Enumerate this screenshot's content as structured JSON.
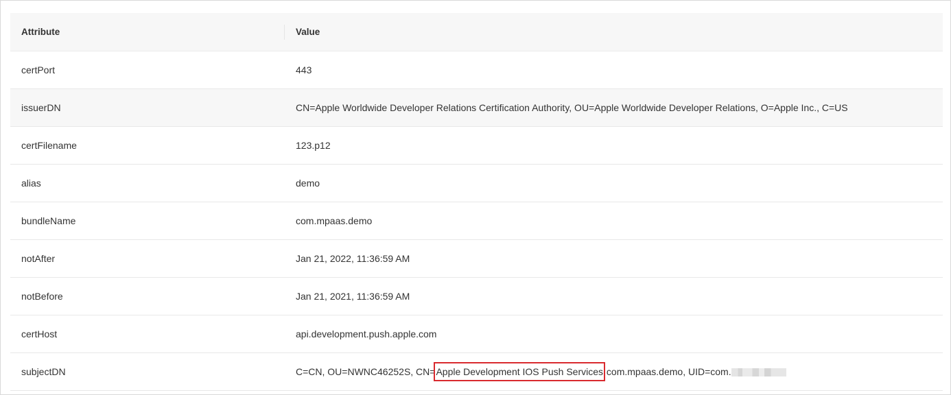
{
  "table": {
    "headers": {
      "attribute": "Attribute",
      "value": "Value"
    },
    "rows": [
      {
        "attribute": "certPort",
        "value": "443"
      },
      {
        "attribute": "issuerDN",
        "value": "CN=Apple Worldwide Developer Relations Certification Authority, OU=Apple Worldwide Developer Relations, O=Apple Inc., C=US"
      },
      {
        "attribute": "certFilename",
        "value": "123.p12"
      },
      {
        "attribute": "alias",
        "value": "demo"
      },
      {
        "attribute": "bundleName",
        "value": "com.mpaas.demo"
      },
      {
        "attribute": "notAfter",
        "value": "Jan 21, 2022, 11:36:59 AM"
      },
      {
        "attribute": "notBefore",
        "value": "Jan 21, 2021, 11:36:59 AM"
      },
      {
        "attribute": "certHost",
        "value": "api.development.push.apple.com"
      },
      {
        "attribute": "subjectDN",
        "value_prefix": "C=CN, OU=NWNC46252S, CN=",
        "value_highlight": "Apple Development IOS Push Services",
        "value_suffix": " com.mpaas.demo, UID=com."
      }
    ]
  },
  "colors": {
    "highlight_border": "#d9292e",
    "stripe": "#f7f7f7",
    "divider": "#e8e8e8"
  }
}
